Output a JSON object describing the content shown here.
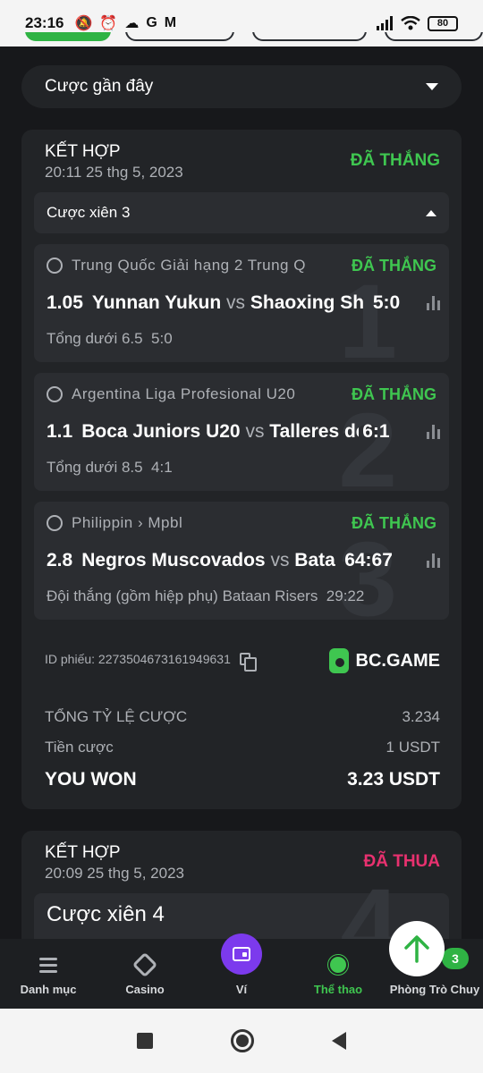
{
  "status_bar": {
    "time": "23:16",
    "left_icons": [
      "mute-icon",
      "alarm-icon",
      "cloud-icon",
      "google-icon",
      "gmail-icon"
    ],
    "battery": "80"
  },
  "recent_bets": {
    "label": "Cược gần đây"
  },
  "bets": [
    {
      "type": "KẾT HỢP",
      "date": "20:11 25 thg 5, 2023",
      "status": "ĐÃ THẮNG",
      "parlay_label": "Cược xiên 3",
      "legs": [
        {
          "index": "1",
          "sport_icon": "soccer-ball-icon",
          "league": "Trung Quốc Giải hạng 2 Trung Q",
          "status": "ĐÃ THẮNG",
          "odds": "1.05",
          "home": "Yunnan Yukun",
          "vs": "vs",
          "away": "Shaoxing Sh",
          "score": "5:0",
          "pick": "Tổng dưới 6.5",
          "pick_score": "5:0"
        },
        {
          "index": "2",
          "sport_icon": "soccer-ball-icon",
          "league": "Argentina Liga Profesional U20",
          "status": "ĐÃ THẮNG",
          "odds": "1.1",
          "home": "Boca Juniors U20",
          "vs": "vs",
          "away": "Talleres de",
          "score": "6:1",
          "pick": "Tổng dưới 8.5",
          "pick_score": "4:1"
        },
        {
          "index": "3",
          "sport_icon": "basketball-icon",
          "league": "Philippin › Mpbl",
          "status": "ĐÃ THẮNG",
          "odds": "2.8",
          "home": "Negros Muscovados",
          "vs": "vs",
          "away": "Bata",
          "score": "64:67",
          "pick": "Đội thắng (gồm hiệp phụ) Bataan Risers",
          "pick_score": "29:22"
        }
      ],
      "ticket_id": "ID phiếu: 227350467316194963​1",
      "brand": "BC.GAME",
      "total_odds_label": "TỔNG TỶ LỆ CƯỢC",
      "total_odds": "3.234",
      "stake_label": "Tiền cược",
      "stake": "1 USDT",
      "won_label": "YOU WON",
      "won": "3.23 USDT"
    },
    {
      "type": "KẾT HỢP",
      "date": "20:09 25 thg 5, 2023",
      "status": "ĐÃ THUA",
      "parlay_label": "Cược xiên 4",
      "index": "4"
    }
  ],
  "bottom_nav": [
    {
      "label": "Danh mục",
      "icon": "menu-icon"
    },
    {
      "label": "Casino",
      "icon": "casino-icon"
    },
    {
      "label": "Ví",
      "icon": "wallet-icon"
    },
    {
      "label": "Thể thao",
      "icon": "basketball-icon"
    },
    {
      "label": "Phòng Trò Chuy",
      "icon": "chat-icon",
      "badge": "3"
    }
  ],
  "colors": {
    "win": "#3fc650",
    "lose": "#e8316f",
    "wallet": "#7c3aed"
  }
}
